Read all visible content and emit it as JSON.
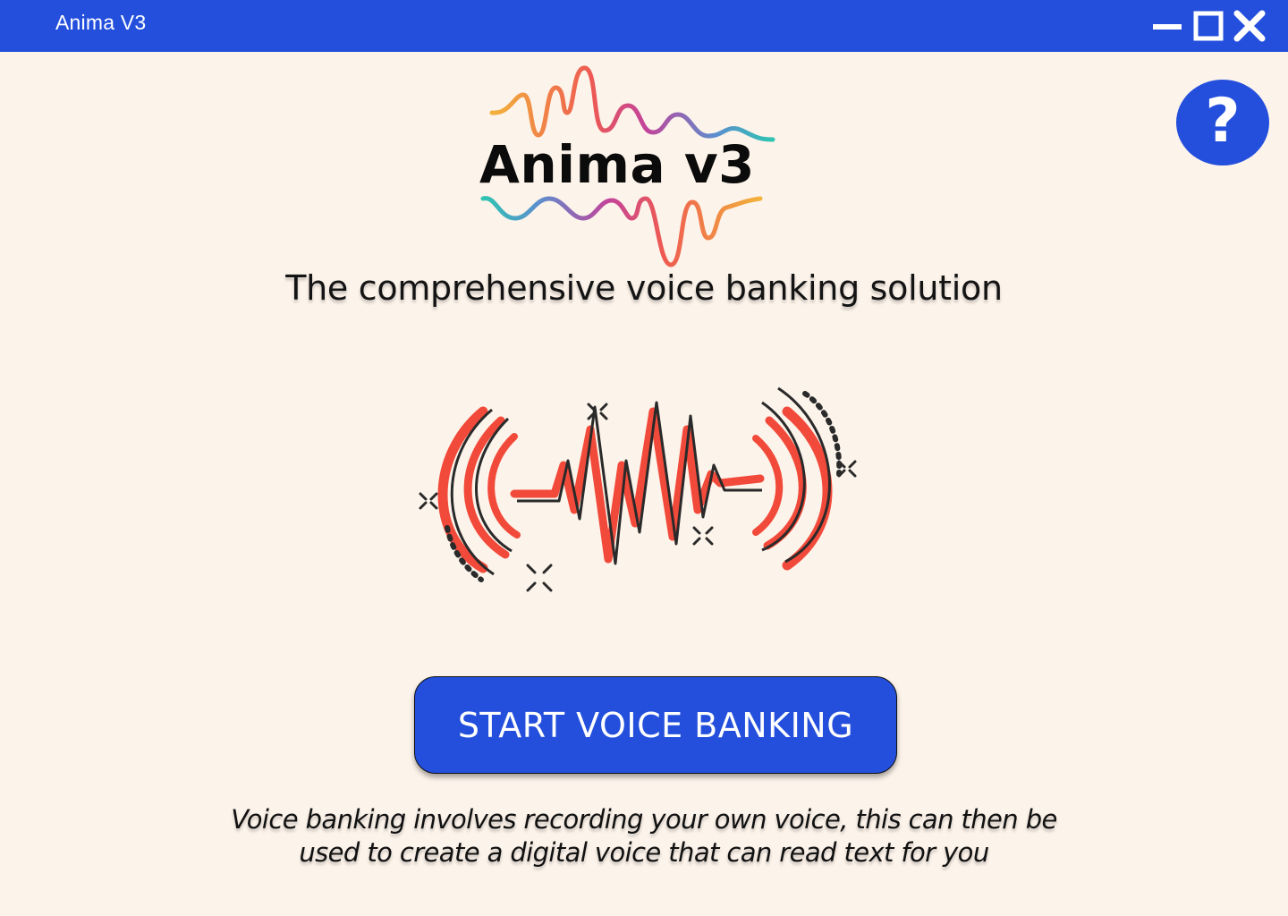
{
  "window": {
    "title": "Anima V3",
    "controls": [
      "minimize-icon",
      "maximize-icon",
      "close-icon"
    ]
  },
  "help": {
    "label": "?",
    "icon": "help-icon"
  },
  "logo": {
    "title": "Anima v3"
  },
  "tagline": "The comprehensive voice banking solution",
  "start_button": {
    "label": "START VOICE BANKING"
  },
  "description": {
    "line1": "Voice banking involves recording your own voice, this can then be",
    "line2": "used to create a digital voice that can read text for you"
  },
  "colors": {
    "brand_blue": "#234fdc",
    "background": "#fcf3ea",
    "wave_red": "#f24a3a",
    "wave_dark": "#2a2a2a"
  }
}
